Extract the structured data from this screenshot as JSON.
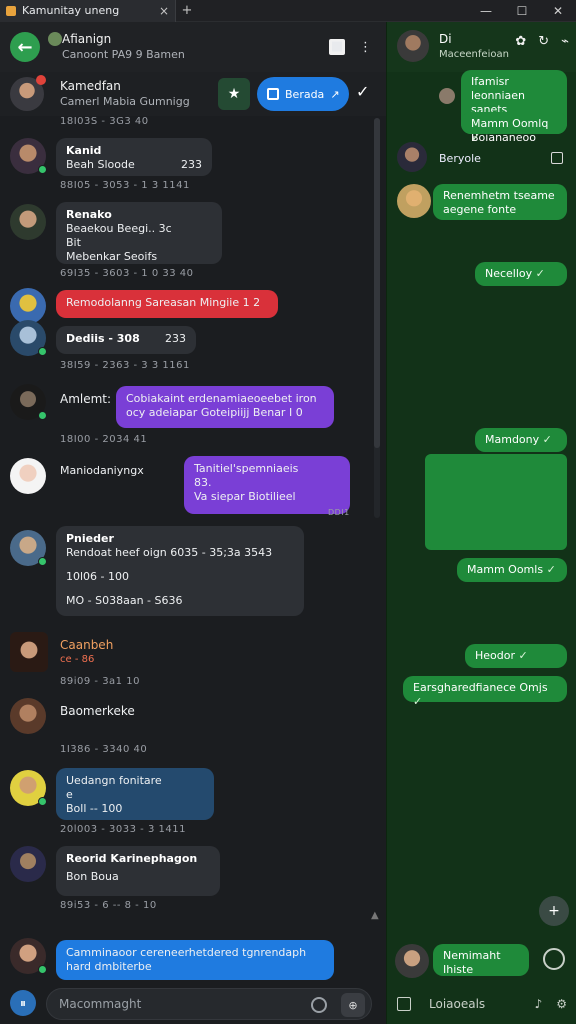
{
  "window": {
    "tab_title": "Kamunitay uneng",
    "tab_close": "×",
    "new_tab": "+",
    "minimize": "—",
    "maximize": "☐",
    "close": "✕"
  },
  "left_header": {
    "title": "Afianign",
    "subtitle": "Canoont PA9 9 Bamen",
    "back_icon": "←",
    "bookmark_icon": "■",
    "menu_icon": "⋮"
  },
  "pinned": {
    "name": "Kamedfan",
    "sub": "Camerl Mabia Gumnigg",
    "star_icon": "★",
    "pill_label": "Berada",
    "pill_icon": "↗",
    "check_icon": "✓"
  },
  "messages": [
    {
      "meta": "18I03S - 3G3 40"
    },
    {
      "name": "Kanid",
      "text": "Beah Sloode",
      "emoji": "233",
      "meta": "88I05 - 3053 - 1 3 1141"
    },
    {
      "name": "Renako",
      "line1": "Beaekou Beegi.. 3c",
      "line2": "Bit",
      "line3": "Mebenkar Seoifs",
      "meta": "69I35 - 3603 - 1 0 33 40"
    },
    {
      "text": "Remodolanng Sareasan Mingiie 1 2"
    },
    {
      "name": "Dediis - 308",
      "emoji": "233",
      "meta": "38I59 - 2363 - 3 3 1161"
    },
    {
      "name": "Amlemt:",
      "text": "Cobiakaint erdenamiaeoeebet iron ocy adeiapar Goteipiijj Benar I 0",
      "meta": "18I00 - 2034 41"
    },
    {
      "name": "Maniodaniyngx",
      "line1": "Tanitiel'spemniaeis",
      "line2": "83.",
      "line3": "Va siepar Biotilieel",
      "corner": "DDI1"
    },
    {
      "name": "Pnieder",
      "line1": "Rendoat heef oign 6035 - 35;3a 3543",
      "line2": "10l06 - 100",
      "line3": "MO - S038aan - S636"
    },
    {
      "name": "Caanbeh",
      "line1": "ce - 86",
      "meta": "89i09 - 3a1 10"
    },
    {
      "name": "Baomerkeke",
      "meta": "1I386 - 3340 40"
    },
    {
      "name": "Uedangn fonitare",
      "line1": "e",
      "line2": "Boll -- 100",
      "meta": "20l003 - 3033 - 3 1411"
    },
    {
      "name": "Reorid Karinephagon",
      "line1": "Bon Boua",
      "meta": "89i53 - 6 -- 8 - 10"
    },
    {
      "text": "Camminaoor cereneerhetdered tgnrendaph hard dmbiterbe"
    }
  ],
  "composer": {
    "placeholder": "Macommaght",
    "left_icon": "⏸",
    "send_icon": "⊕"
  },
  "right_header": {
    "title": "Di",
    "subtitle": "Maceenfeioan"
  },
  "right_messages": [
    {
      "text": "Ifamisr leonniaen sanets ceoeoan Boiananeoo"
    },
    {
      "text": "Mamm Oomlq"
    },
    {
      "name": "Beryole"
    },
    {
      "text": "Renemhetm tseame aegene fonte"
    },
    {
      "text": "Necelloy"
    },
    {
      "text": "Mamdony"
    },
    {
      "text": "Mamm Oomls"
    },
    {
      "text": "Heodor"
    },
    {
      "text": "Earsgharedfianece Omjs"
    },
    {
      "text": "Nemimaht Ihiste"
    }
  ],
  "right_composer": {
    "label": "Loiaoeals",
    "fab_icon": "+"
  },
  "colors": {
    "green_bubble": "#1f8a3a",
    "red_bubble": "#d9313a",
    "purple_bubble": "#7a3fd6",
    "blue_bubble": "#1f7be0"
  }
}
